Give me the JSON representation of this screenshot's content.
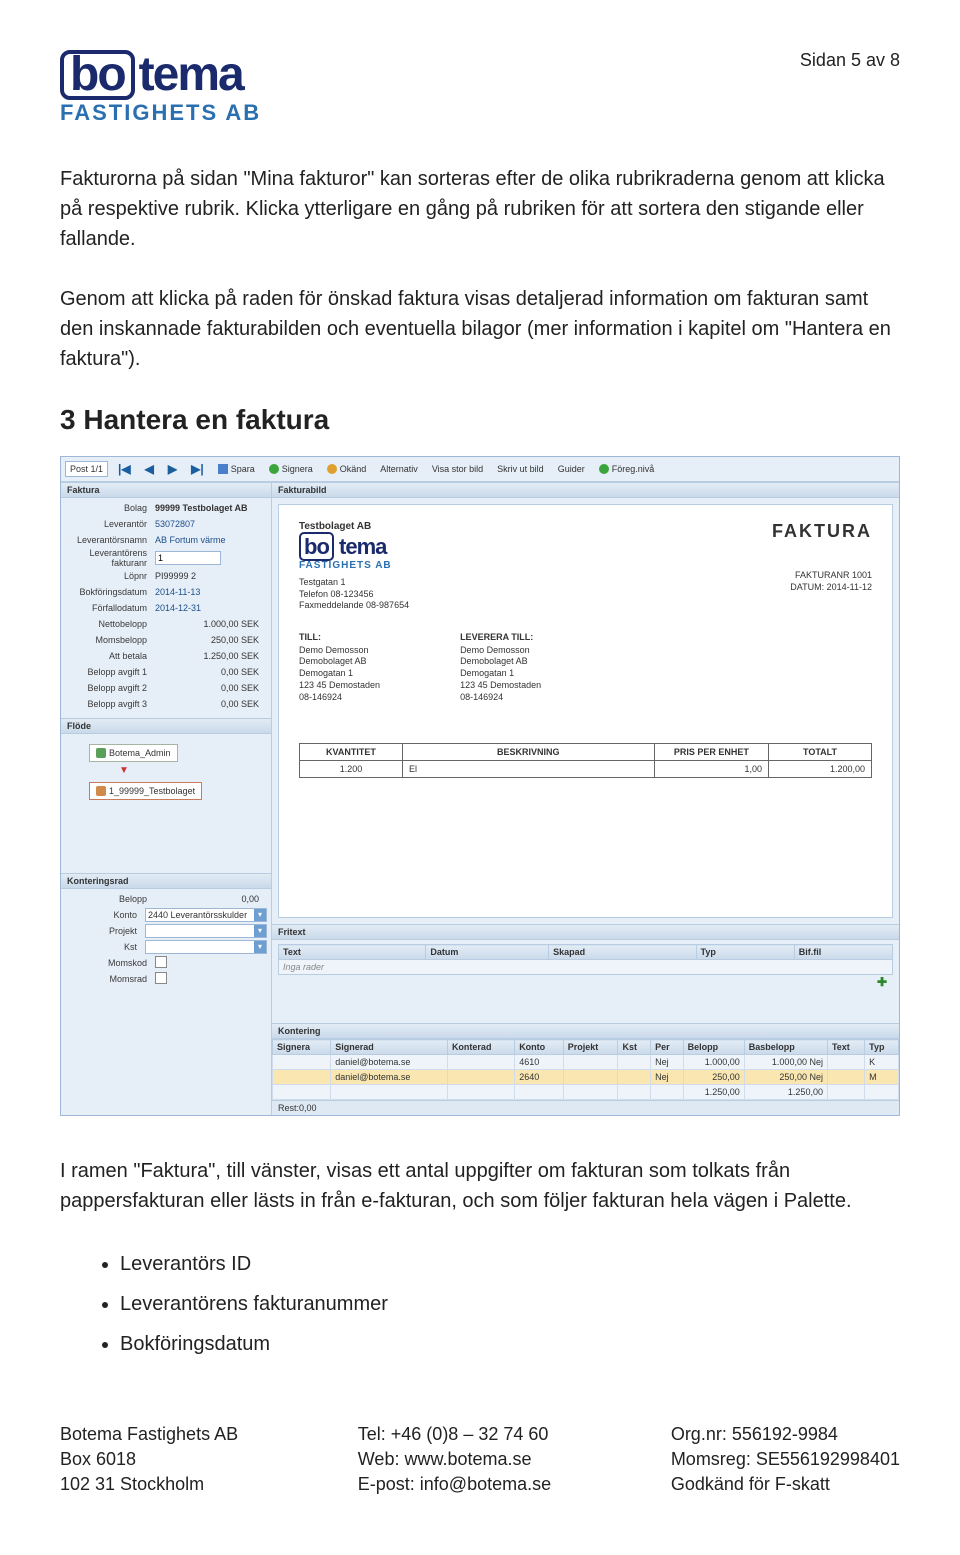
{
  "page_num": "Sidan 5 av 8",
  "logo": {
    "bo": "bo",
    "tema": "tema",
    "sub": "FASTIGHETS AB"
  },
  "para1": "Fakturorna på sidan \"Mina fakturor\" kan sorteras efter de olika rubrikraderna genom att klicka på respektive rubrik. Klicka ytterligare en gång på rubriken för att sortera den stigande eller fallande.",
  "para2": "Genom att klicka på raden för önskad faktura visas detaljerad information om fakturan samt den inskannade fakturabilden och eventuella bilagor (mer information i kapitel om \"Hantera en faktura\").",
  "section_title": "3  Hantera en faktura",
  "para3": "I ramen \"Faktura\", till vänster, visas ett antal uppgifter om fakturan som tolkats från pappersfakturan eller lästs in från e-fakturan, och som följer fakturan hela vägen i Palette.",
  "bullets": [
    "Leverantörs ID",
    "Leverantörens fakturanummer",
    "Bokföringsdatum"
  ],
  "footer": {
    "c1": [
      "Botema Fastighets AB",
      "Box 6018",
      "102 31 Stockholm"
    ],
    "c2": [
      "Tel: +46 (0)8 – 32 74 60",
      "Web: www.botema.se",
      "E-post: info@botema.se"
    ],
    "c3": [
      "Org.nr: 556192-9984",
      "Momsreg: SE556192998401",
      "Godkänd för F-skatt"
    ]
  },
  "app": {
    "toolbar": {
      "post": "Post 1/1",
      "spara": "Spara",
      "signera": "Signera",
      "okand": "Okänd",
      "alternativ": "Alternativ",
      "visa": "Visa stor bild",
      "skriv": "Skriv ut bild",
      "guider": "Guider",
      "foreg": "Föreg.nivå"
    },
    "panels": {
      "faktura": "Faktura",
      "fakturabild": "Fakturabild",
      "flode": "Flöde",
      "konteringsrad": "Konteringsrad",
      "fritext": "Fritext",
      "kontering": "Kontering"
    },
    "faktura_fields": {
      "bolag_l": "Bolag",
      "bolag_v": "99999 Testbolaget AB",
      "leverantor_l": "Leverantör",
      "leverantor_v": "53072807",
      "levnamn_l": "Leverantörsnamn",
      "levnamn_v": "AB Fortum värme",
      "levfaktnr_l": "Leverantörens fakturanr",
      "levfaktnr_v": "1",
      "lopnr_l": "Löpnr",
      "lopnr_v": "PI99999 2",
      "bokdatum_l": "Bokföringsdatum",
      "bokdatum_v": "2014-11-13",
      "forfdatum_l": "Förfallodatum",
      "forfdatum_v": "2014-12-31",
      "netto_l": "Nettobelopp",
      "netto_v": "1.000,00 SEK",
      "moms_l": "Momsbelopp",
      "moms_v": "250,00 SEK",
      "attbetala_l": "Att betala",
      "attbetala_v": "1.250,00 SEK",
      "a1_l": "Belopp avgift 1",
      "a1_v": "0,00 SEK",
      "a2_l": "Belopp avgift 2",
      "a2_v": "0,00 SEK",
      "a3_l": "Belopp avgift 3",
      "a3_v": "0,00 SEK"
    },
    "flow": {
      "admin": "Botema_Admin",
      "test": "1_99999_Testbolaget"
    },
    "konteringsrad": {
      "belopp_l": "Belopp",
      "belopp_v": "0,00",
      "konto_l": "Konto",
      "konto_v": "2440 Leverantörsskulder",
      "projekt_l": "Projekt",
      "kst_l": "Kst",
      "momskod_l": "Momskod",
      "momsrad_l": "Momsrad"
    },
    "invoice": {
      "company": "Testbolaget AB",
      "logo_bo": "bo",
      "logo_tema": "tema",
      "logo_sub": "FASTIGHETS AB",
      "addr1": "Testgatan 1",
      "addr2": "Telefon 08-123456",
      "addr3": "Faxmeddelande 08-987654",
      "title": "FAKTURA",
      "meta1": "FAKTURANR 1001",
      "meta2": "DATUM: 2014-11-12",
      "till_h": "TILL:",
      "lev_h": "LEVERERA TILL:",
      "blk": [
        "Demo Demosson",
        "Demobolaget AB",
        "Demogatan 1",
        "123 45 Demostaden",
        "08-146924"
      ],
      "th_kv": "KVANTITET",
      "th_be": "BESKRIVNING",
      "th_pr": "PRIS PER ENHET",
      "th_to": "TOTALT",
      "row_kv": "1.200",
      "row_be": "El",
      "row_pr": "1,00",
      "row_to": "1.200,00"
    },
    "fritext": {
      "h_text": "Text",
      "h_datum": "Datum",
      "h_skapad": "Skapad",
      "h_typ": "Typ",
      "h_bif": "Bif.fil",
      "empty": "Inga rader"
    },
    "kontering": {
      "h_signera": "Signera",
      "h_signerad": "Signerad",
      "h_konterad": "Konterad",
      "h_konto": "Konto",
      "h_projekt": "Projekt",
      "h_kst": "Kst",
      "h_per": "Per",
      "h_belopp": "Belopp",
      "h_basbelopp": "Basbelopp",
      "h_text": "Text",
      "h_typ": "Typ",
      "r1_sign": "daniel@botema.se",
      "r1_konto": "4610",
      "r1_per": "Nej",
      "r1_belopp": "1.000,00",
      "r1_bas": "1.000,00 Nej",
      "r1_typ": "K",
      "r2_sign": "daniel@botema.se",
      "r2_konto": "2640",
      "r2_per": "Nej",
      "r2_belopp": "250,00",
      "r2_bas": "250,00 Nej",
      "r2_typ": "M",
      "sum_belopp": "1.250,00",
      "sum_bas": "1.250,00",
      "rest": "Rest:0,00"
    }
  }
}
